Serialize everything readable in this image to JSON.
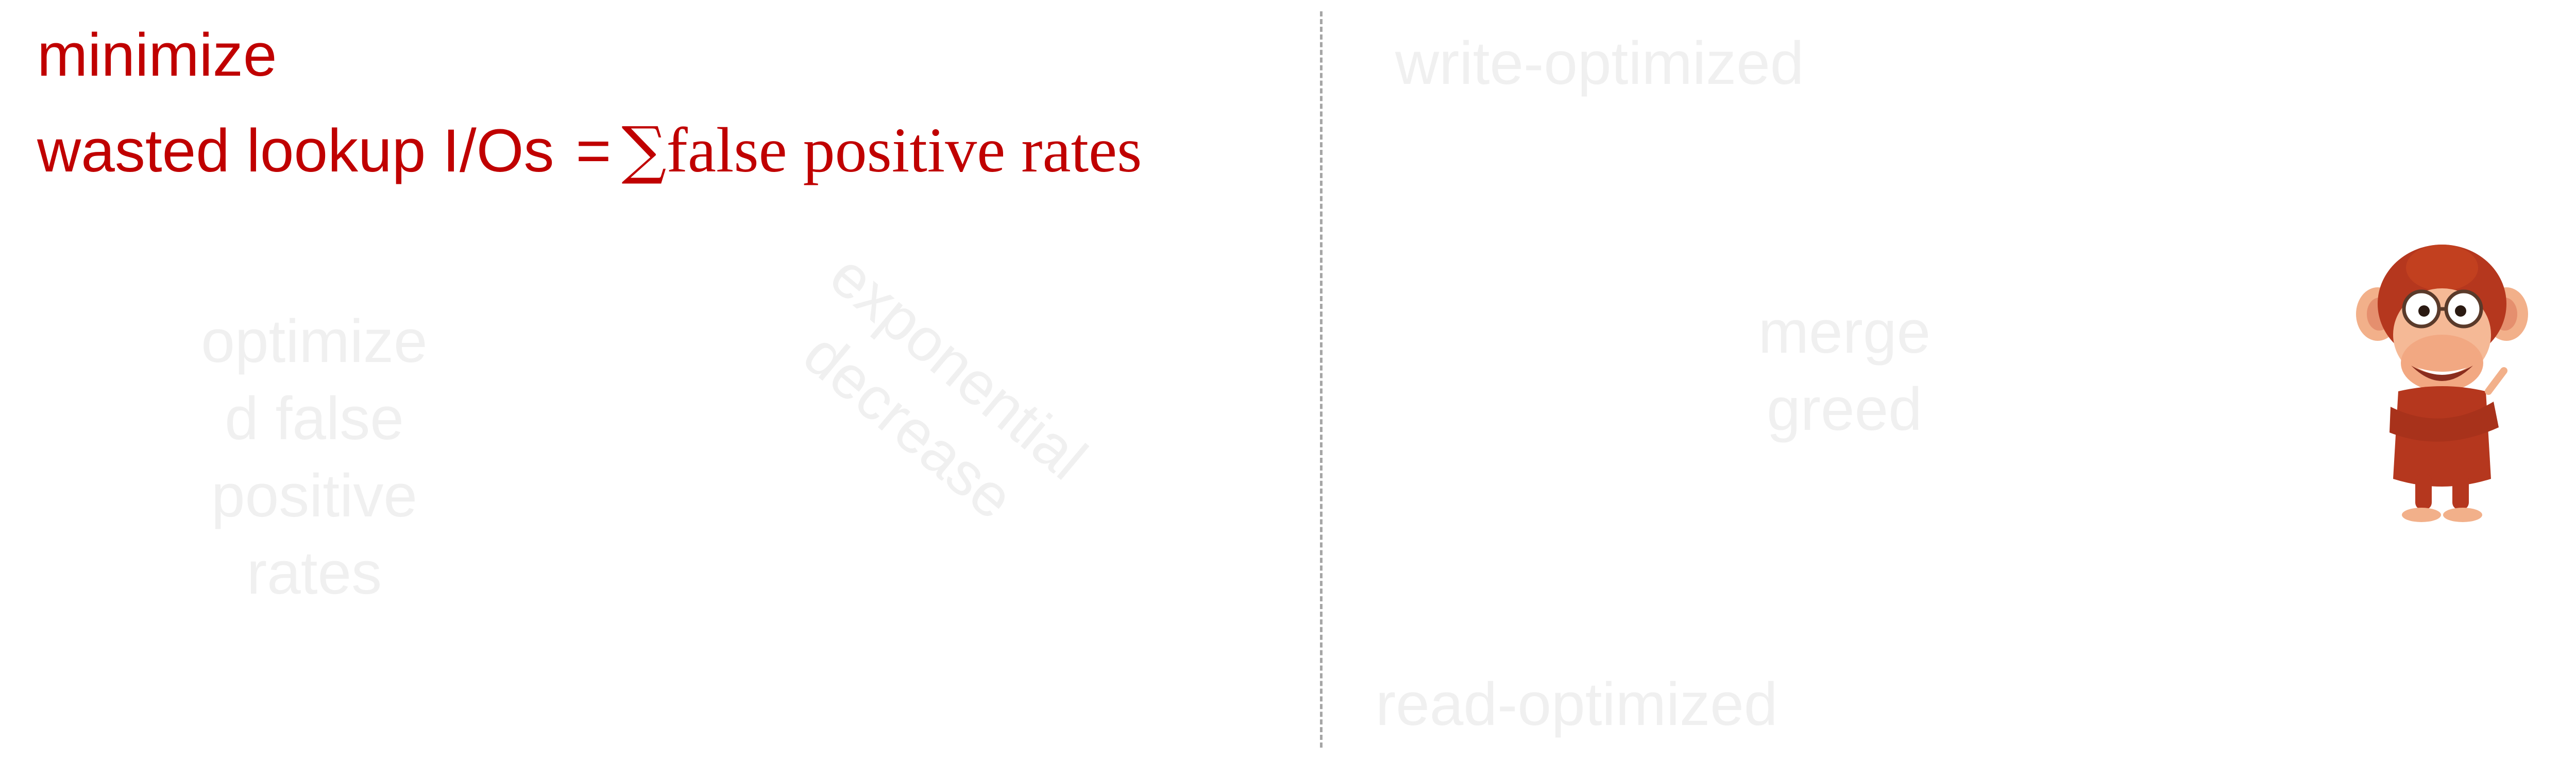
{
  "left_panel": {
    "line1": "minimize",
    "line2_text": "wasted lookup I/Os",
    "equals": "=",
    "sum_symbol": "∑",
    "line2_formula": "false positive rates",
    "optimized_lines": [
      "optimize",
      "d false",
      "positive",
      "rates"
    ],
    "diagonal_lines": [
      "exponential",
      "decrease"
    ]
  },
  "right_panel": {
    "top_label": "write-optimized",
    "bottom_label": "read-optimized",
    "center_lines": [
      "merge",
      "greed"
    ],
    "mascot_icon": "monkey-with-glasses-icon"
  },
  "colors": {
    "accent_red": "#c00000",
    "faint_text": "#f0f0f0",
    "divider": "#a6a6a6"
  }
}
